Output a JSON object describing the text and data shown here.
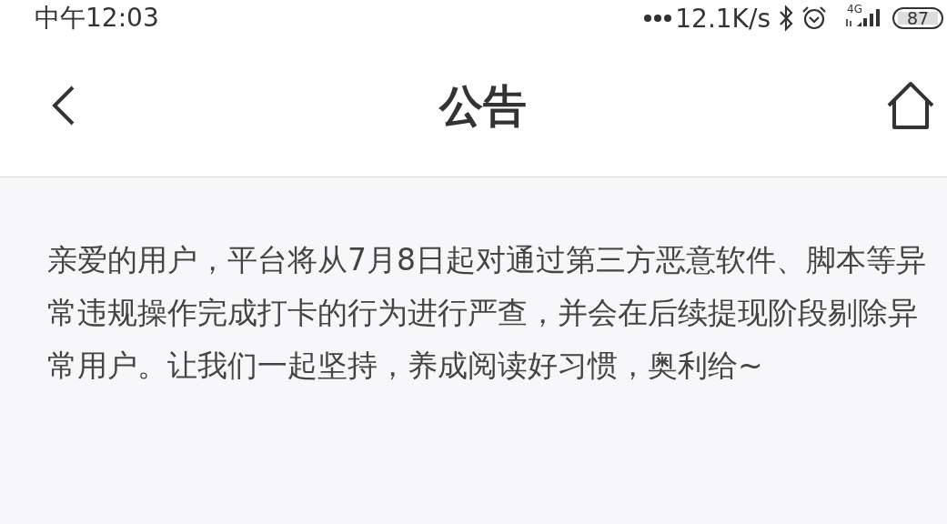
{
  "status_bar": {
    "time": "中午12:03",
    "network_speed": "12.1K/s",
    "network_type": "4G",
    "battery": "87"
  },
  "header": {
    "title": "公告"
  },
  "notice": {
    "text": "亲爱的用户，平台将从7月8日起对通过第三方恶意软件、脚本等异常违规操作完成打卡的行为进行严查，并会在后续提现阶段剔除异常用户。让我们一起坚持，养成阅读好习惯，奥利给~"
  }
}
